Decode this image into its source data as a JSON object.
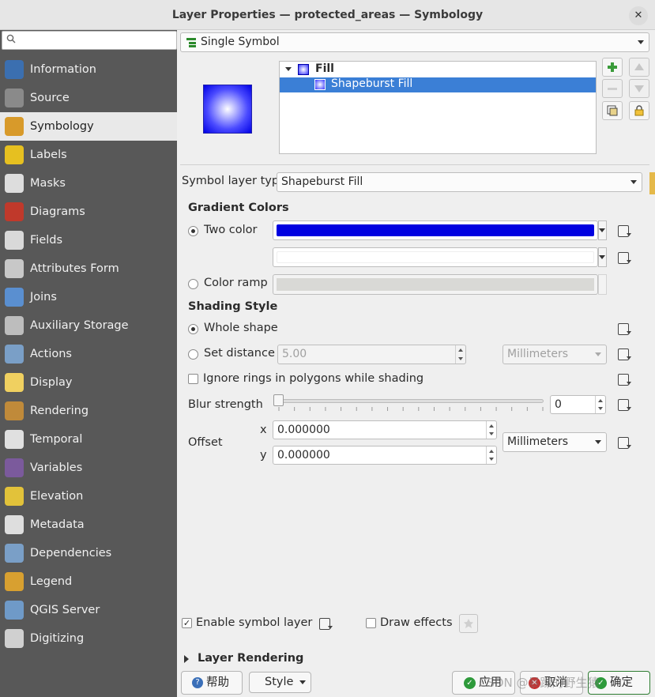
{
  "window": {
    "title": "Layer Properties — protected_areas — Symbology",
    "close": "✕"
  },
  "search": {
    "placeholder": ""
  },
  "sidebar": {
    "items": [
      {
        "label": "Information",
        "icon": "information-icon"
      },
      {
        "label": "Source",
        "icon": "source-icon"
      },
      {
        "label": "Symbology",
        "icon": "symbology-icon"
      },
      {
        "label": "Labels",
        "icon": "labels-icon"
      },
      {
        "label": "Masks",
        "icon": "masks-icon"
      },
      {
        "label": "Diagrams",
        "icon": "diagrams-icon"
      },
      {
        "label": "Fields",
        "icon": "fields-icon"
      },
      {
        "label": "Attributes Form",
        "icon": "attributes-form-icon"
      },
      {
        "label": "Joins",
        "icon": "joins-icon"
      },
      {
        "label": "Auxiliary Storage",
        "icon": "auxiliary-storage-icon"
      },
      {
        "label": "Actions",
        "icon": "actions-icon"
      },
      {
        "label": "Display",
        "icon": "display-icon"
      },
      {
        "label": "Rendering",
        "icon": "rendering-icon"
      },
      {
        "label": "Temporal",
        "icon": "temporal-icon"
      },
      {
        "label": "Variables",
        "icon": "variables-icon"
      },
      {
        "label": "Elevation",
        "icon": "elevation-icon"
      },
      {
        "label": "Metadata",
        "icon": "metadata-icon"
      },
      {
        "label": "Dependencies",
        "icon": "dependencies-icon"
      },
      {
        "label": "Legend",
        "icon": "legend-icon"
      },
      {
        "label": "QGIS Server",
        "icon": "qgis-server-icon"
      },
      {
        "label": "Digitizing",
        "icon": "digitizing-icon"
      }
    ],
    "selected": "Symbology"
  },
  "renderer": {
    "value": "Single Symbol"
  },
  "symbol_tree": {
    "root": "Fill",
    "child": "Shapeburst Fill"
  },
  "symbol_layer_type": {
    "label": "Symbol layer type",
    "value": "Shapeburst Fill"
  },
  "gradient": {
    "heading": "Gradient Colors",
    "two_color": "Two color",
    "color_ramp": "Color ramp",
    "color1": "#0000e0",
    "color2": "#ffffff"
  },
  "shading": {
    "heading": "Shading Style",
    "whole_shape": "Whole shape",
    "set_distance": "Set distance",
    "distance_value": "5.00",
    "distance_unit": "Millimeters",
    "ignore_rings": "Ignore rings in polygons while shading"
  },
  "blur": {
    "label": "Blur strength",
    "value": "0",
    "level": 0
  },
  "offset": {
    "label": "Offset",
    "x_label": "x",
    "y_label": "y",
    "x": "0.000000",
    "y": "0.000000",
    "unit": "Millimeters"
  },
  "enable_symbol_layer": "Enable symbol layer",
  "draw_effects": "Draw effects",
  "layer_rendering": "Layer Rendering",
  "buttons": {
    "help": "帮助",
    "style": "Style",
    "apply": "应用",
    "cancel": "取消",
    "ok": "确定"
  },
  "watermark": "CSDN @暴躁的野生猿"
}
